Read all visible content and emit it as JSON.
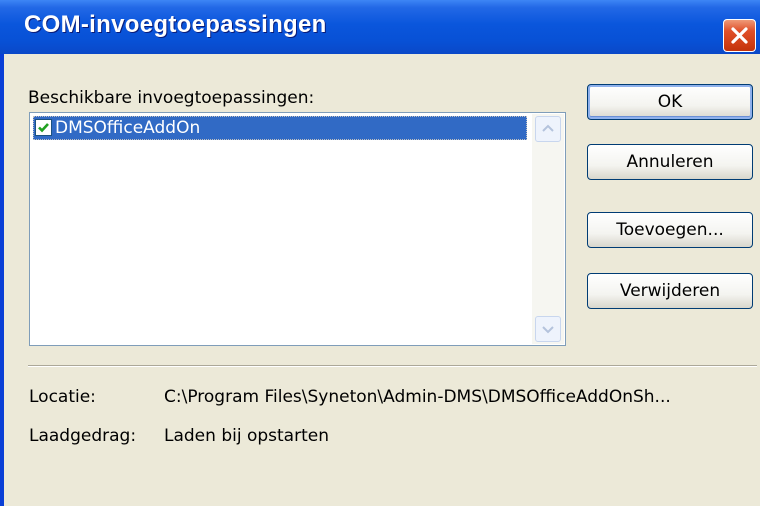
{
  "dialog": {
    "title": "COM-invoegtoepassingen",
    "available_label": "Beschikbare invoegtoepassingen:",
    "addins": [
      {
        "label": "DMSOfficeAddOn",
        "checked": true,
        "selected": true
      }
    ],
    "buttons": {
      "ok": "OK",
      "cancel": "Annuleren",
      "add": "Toevoegen...",
      "remove": "Verwijderen"
    },
    "location": {
      "label": "Locatie:",
      "value": "C:\\Program Files\\Syneton\\Admin-DMS\\DMSOfficeAddOnSh..."
    },
    "load_behavior": {
      "label": "Laadgedrag:",
      "value": "Laden bij opstarten"
    }
  },
  "colors": {
    "titlebar": "#0a56dc",
    "dialog_face": "#ece9d8",
    "selection": "#316ac5",
    "close_button": "#d03e16",
    "checkmark": "#21a121"
  },
  "icons": {
    "close": "close-icon",
    "check": "checkmark-icon",
    "scroll_up": "chevron-up-icon",
    "scroll_down": "chevron-down-icon"
  }
}
